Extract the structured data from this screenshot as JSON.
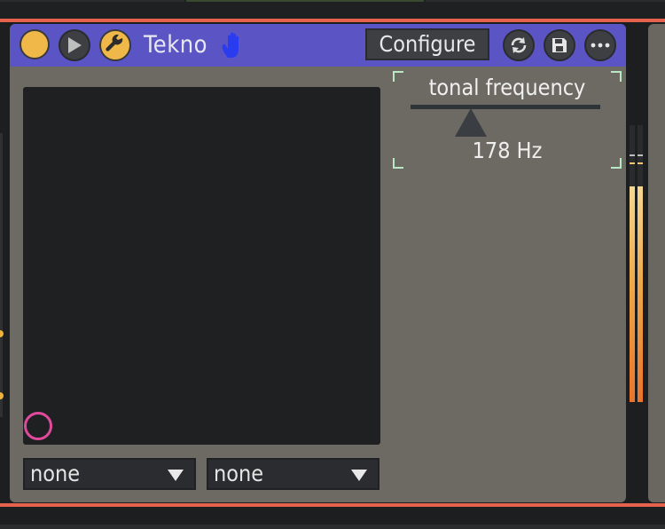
{
  "device": {
    "title": "Tekno",
    "configure_label": "Configure",
    "power_state": "on",
    "colors": {
      "header": "#5a54c4",
      "body": "#6d6a64",
      "accent": "#f0b848",
      "cursor": "#e04a9c"
    }
  },
  "icons": {
    "power": "power-icon",
    "play": "play-icon",
    "wrench": "wrench-icon",
    "hand": "hand-icon",
    "refresh": "refresh-icon",
    "save": "save-icon",
    "more": "more-icon"
  },
  "xy_pad": {
    "x_param": "none",
    "y_param": "none"
  },
  "parameter": {
    "label": "tonal frequency",
    "value_text": "178 Hz",
    "position": 0.32
  },
  "meters": {
    "left_level": 0.78,
    "right_level": 0.78
  }
}
